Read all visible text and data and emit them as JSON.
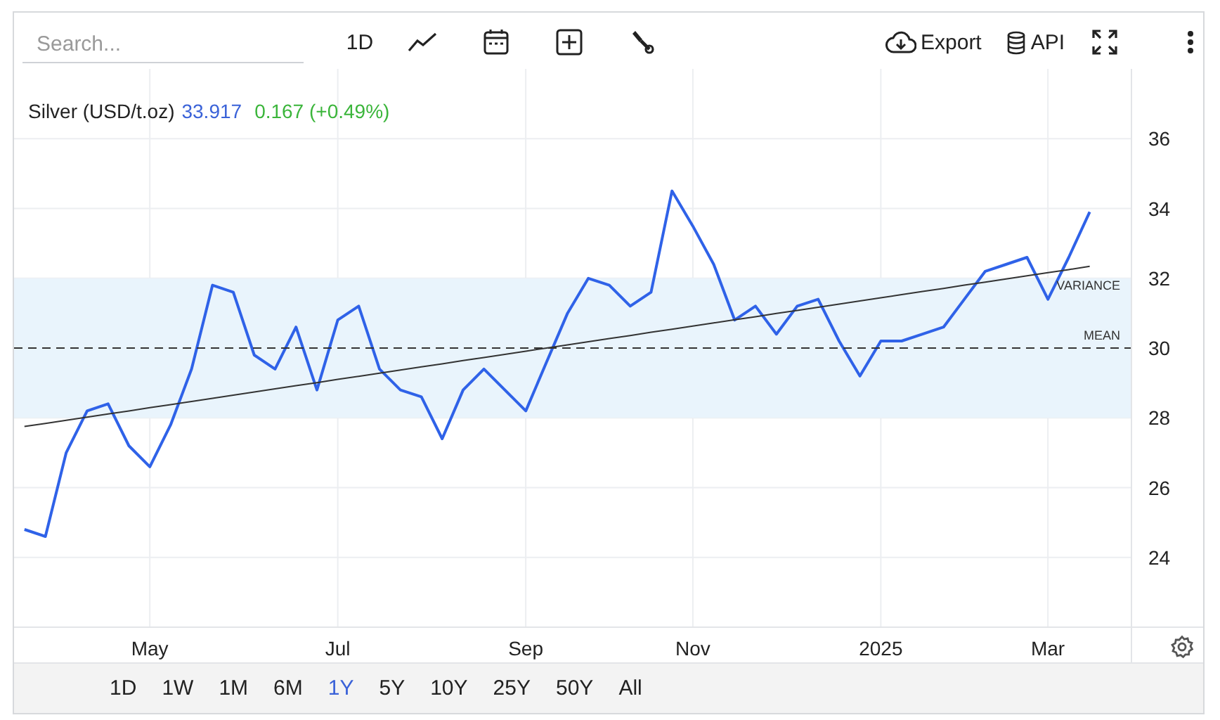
{
  "search": {
    "placeholder": "Search..."
  },
  "toolbar": {
    "interval": "1D",
    "export": "Export",
    "api": "API"
  },
  "chart": {
    "legend": {
      "price": "33.917",
      "change": "0.167 (+0.49%)"
    },
    "chart_data": {
      "type": "line",
      "categories": [
        null,
        null,
        null,
        null,
        null,
        null,
        "May",
        null,
        null,
        null,
        null,
        null,
        null,
        null,
        null,
        "Jul",
        null,
        null,
        null,
        null,
        null,
        null,
        null,
        null,
        "Sep",
        null,
        null,
        null,
        null,
        null,
        null,
        null,
        "Nov",
        null,
        null,
        null,
        null,
        null,
        null,
        null,
        null,
        "2025",
        null,
        null,
        null,
        null,
        null,
        null,
        null,
        "Mar",
        null,
        null
      ],
      "series": [
        {
          "name": "Silver (USD/t.oz)",
          "color": "#2f62e8",
          "values": [
            24.8,
            24.6,
            27,
            28.2,
            28.4,
            27.2,
            26.6,
            27.8,
            29.4,
            31.8,
            31.6,
            29.8,
            29.4,
            30.6,
            28.8,
            30.8,
            31.2,
            29.4,
            28.8,
            28.6,
            27.4,
            28.8,
            29.4,
            28.8,
            28.2,
            29.6,
            31,
            32,
            31.8,
            31.2,
            31.6,
            34.5,
            33.5,
            32.4,
            30.8,
            31.2,
            30.4,
            31.2,
            31.4,
            30.2,
            29.2,
            30.2,
            30.2,
            30.4,
            30.6,
            31.4,
            32.2,
            32.4,
            32.6,
            31.4,
            32.6,
            33.9
          ]
        },
        {
          "color": "#333333",
          "values": [
            27.75,
            27.84,
            27.93,
            28.02,
            28.11,
            28.2,
            28.29,
            28.38,
            28.47,
            28.56,
            28.65,
            28.74,
            28.83,
            28.92,
            29.01,
            29.1,
            29.19,
            29.28,
            29.37,
            29.46,
            29.55,
            29.64,
            29.73,
            29.82,
            29.91,
            30,
            30.09,
            30.18,
            30.27,
            30.36,
            30.45,
            30.54,
            30.63,
            30.72,
            30.81,
            30.9,
            30.99,
            31.08,
            31.17,
            31.26,
            31.35,
            31.44,
            31.53,
            31.62,
            31.71,
            31.8,
            31.89,
            31.98,
            32.07,
            32.16,
            32.25,
            32.34
          ]
        }
      ],
      "ylim": [
        22,
        38
      ],
      "grid": true,
      "yticks": [
        24,
        26,
        28,
        30,
        32,
        34,
        36
      ],
      "bands": [
        {
          "label": "VARIANCE",
          "axis": "y",
          "from": 28,
          "to": 32
        }
      ],
      "ref_lines": [
        {
          "label": "MEAN",
          "axis": "y",
          "value": 30
        }
      ]
    }
  },
  "ranges": [
    {
      "label": "1D",
      "selected": false
    },
    {
      "label": "1W",
      "selected": false
    },
    {
      "label": "1M",
      "selected": false
    },
    {
      "label": "6M",
      "selected": false
    },
    {
      "label": "1Y",
      "selected": true
    },
    {
      "label": "5Y",
      "selected": false
    },
    {
      "label": "10Y",
      "selected": false
    },
    {
      "label": "25Y",
      "selected": false
    },
    {
      "label": "50Y",
      "selected": false
    },
    {
      "label": "All",
      "selected": false
    }
  ]
}
